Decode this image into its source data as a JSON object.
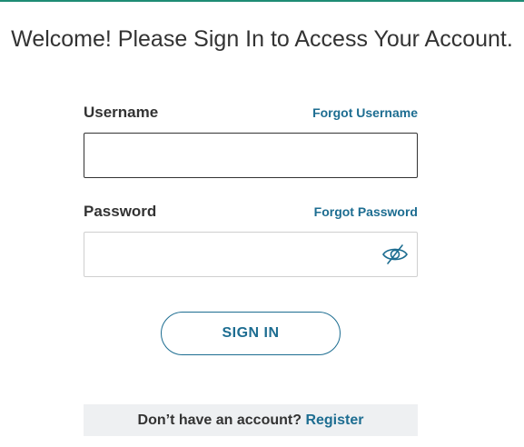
{
  "header": {
    "title": "Welcome! Please Sign In to Access Your Account."
  },
  "username": {
    "label": "Username",
    "forgot_link": "Forgot Username",
    "value": "",
    "placeholder": ""
  },
  "password": {
    "label": "Password",
    "forgot_link": "Forgot Password",
    "value": "",
    "placeholder": "",
    "toggle_icon": "eye-slash-icon"
  },
  "actions": {
    "sign_in_label": "SIGN IN"
  },
  "register": {
    "prompt": "Don’t have an account?",
    "link_label": "Register"
  },
  "colors": {
    "accent": "#1d6d91",
    "top_border": "#1e8c75",
    "text": "#333333",
    "register_bar_bg": "#eef0f2"
  }
}
